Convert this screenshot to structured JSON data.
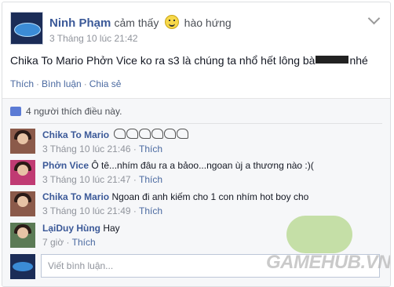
{
  "post": {
    "author": "Ninh Phạm",
    "feeling_prefix": "cảm thấy",
    "feeling_icon": "grinning-face-icon",
    "feeling_text": "hào hứng",
    "timestamp": "3 Tháng 10 lúc 21:42",
    "text_before": "Chika To Mario Phởn Vice ko ra s3 là chúng ta nhổ hết lông bà",
    "text_after": "nhé",
    "actions": {
      "like": "Thích",
      "comment": "Bình luận",
      "share": "Chia sẻ"
    }
  },
  "likes": {
    "text": "4 người thích điều này."
  },
  "comments": [
    {
      "author": "Chika To Mario",
      "text": "",
      "time": "3 Tháng 10 lúc 21:46",
      "like": "Thích"
    },
    {
      "author": "Phởn Vice",
      "text": "Ô tê...nhím đâu ra a bảoo...ngoan ùj a thương nào :)(",
      "time": "3 Tháng 10 lúc 21:47",
      "like": "Thích"
    },
    {
      "author": "Chika To Mario",
      "text": "Ngoan đi anh kiếm cho 1 con nhím hot boy cho",
      "time": "3 Tháng 10 lúc 21:49",
      "like": "Thích"
    },
    {
      "author": "LạiDuy Hùng",
      "text": "Hay",
      "time": "7 giờ",
      "like": "Thích"
    }
  ],
  "compose": {
    "placeholder": "Viết bình luận..."
  },
  "watermark": {
    "text": "GAMEHUB.VN"
  },
  "colors": {
    "link": "#3b5998",
    "meta": "#90949c",
    "feedback_bg": "#f6f7f9"
  }
}
